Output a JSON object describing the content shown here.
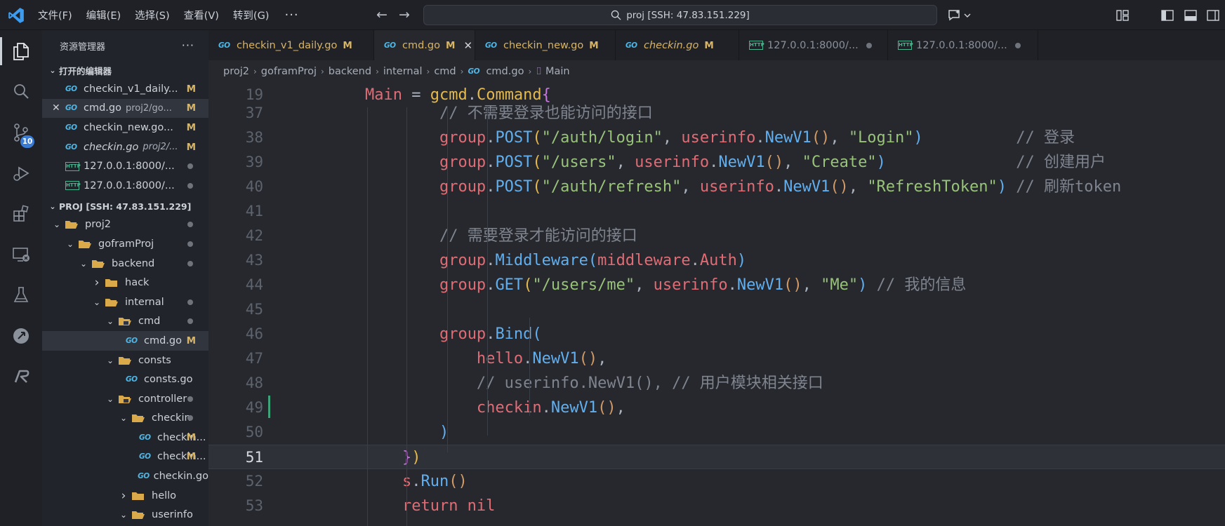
{
  "titlebar": {
    "menus": [
      "文件(F)",
      "编辑(E)",
      "选择(S)",
      "查看(V)",
      "转到(G)"
    ],
    "more": "···",
    "search_text": "proj [SSH: 47.83.151.229]"
  },
  "activity": {
    "scm_badge": "10"
  },
  "sidebar": {
    "title": "资源管理器",
    "more": "···",
    "open_editors_title": "打开的编辑器",
    "open_editors": [
      {
        "name": "checkin_v1_daily...",
        "dir": "",
        "status": "M",
        "kind": "go",
        "italic": false
      },
      {
        "name": "cmd.go",
        "dir": "proj2/go...",
        "status": "M",
        "kind": "go",
        "italic": false
      },
      {
        "name": "checkin_new.go...",
        "dir": "",
        "status": "M",
        "kind": "go",
        "italic": false
      },
      {
        "name": "checkin.go",
        "dir": "proj2/...",
        "status": "M",
        "kind": "go",
        "italic": true
      },
      {
        "name": "127.0.0.1:8000/...",
        "dir": "",
        "status": "",
        "kind": "http",
        "italic": false
      },
      {
        "name": "127.0.0.1:8000/...",
        "dir": "",
        "status": "",
        "kind": "http",
        "italic": false
      }
    ],
    "project_title": "PROJ [SSH: 47.83.151.229]",
    "tree": [
      {
        "name": "proj2",
        "type": "folder",
        "open": true,
        "depth": 0,
        "dot": true
      },
      {
        "name": "goframProj",
        "type": "folder",
        "open": true,
        "depth": 1,
        "dot": true
      },
      {
        "name": "backend",
        "type": "folder",
        "open": true,
        "depth": 2,
        "dot": true
      },
      {
        "name": "hack",
        "type": "folder",
        "open": false,
        "depth": 3,
        "dot": false
      },
      {
        "name": "internal",
        "type": "folder",
        "open": true,
        "depth": 3,
        "dot": true
      },
      {
        "name": "cmd",
        "type": "folder-special",
        "open": true,
        "depth": 4,
        "dot": true
      },
      {
        "name": "cmd.go",
        "type": "go",
        "depth": 5,
        "status": "M",
        "selected": true
      },
      {
        "name": "consts",
        "type": "folder",
        "open": true,
        "depth": 4,
        "dot": false
      },
      {
        "name": "consts.go",
        "type": "go",
        "depth": 5,
        "status": ""
      },
      {
        "name": "controller",
        "type": "folder-special",
        "open": true,
        "depth": 4,
        "dot": true
      },
      {
        "name": "checkin",
        "type": "folder",
        "open": true,
        "depth": 5,
        "dot": true
      },
      {
        "name": "checkin...",
        "type": "go",
        "depth": 6,
        "status": "M"
      },
      {
        "name": "checkin...",
        "type": "go",
        "depth": 6,
        "status": "M"
      },
      {
        "name": "checkin.go",
        "type": "go",
        "depth": 6,
        "status": ""
      },
      {
        "name": "hello",
        "type": "folder",
        "open": false,
        "depth": 5,
        "dot": false
      },
      {
        "name": "userinfo",
        "type": "folder",
        "open": true,
        "depth": 5,
        "dot": false
      }
    ]
  },
  "tabs": [
    {
      "label": "checkin_v1_daily.go",
      "status": "M",
      "kind": "go",
      "active": false,
      "italic": false
    },
    {
      "label": "cmd.go",
      "status": "M",
      "kind": "go",
      "active": true,
      "italic": false
    },
    {
      "label": "checkin_new.go",
      "status": "M",
      "kind": "go",
      "active": false,
      "italic": false
    },
    {
      "label": "checkin.go",
      "status": "M",
      "kind": "go",
      "active": false,
      "italic": true
    },
    {
      "label": "127.0.0.1:8000/...",
      "status": "",
      "kind": "http",
      "active": false,
      "italic": false
    },
    {
      "label": "127.0.0.1:8000/...",
      "status": "",
      "kind": "http",
      "active": false,
      "italic": false
    }
  ],
  "breadcrumb": [
    "proj2",
    "goframProj",
    "backend",
    "internal",
    "cmd",
    "cmd.go",
    "Main"
  ],
  "editor": {
    "current_line": "51",
    "lines": [
      {
        "n": "19",
        "tokens": [
          [
            "    ",
            "w"
          ],
          [
            "Main",
            "pink"
          ],
          [
            " = ",
            "w"
          ],
          [
            "gcmd",
            "gold"
          ],
          [
            ".",
            "w"
          ],
          [
            "Command",
            "gold"
          ],
          [
            "{",
            "purple"
          ]
        ]
      },
      {
        "n": "37",
        "tokens": [
          [
            "            ",
            "w"
          ],
          [
            "// 不需要登录也能访问的接口",
            "com"
          ]
        ]
      },
      {
        "n": "38",
        "tokens": [
          [
            "            ",
            "w"
          ],
          [
            "group",
            "pink"
          ],
          [
            ".",
            "w"
          ],
          [
            "POST",
            "blue"
          ],
          [
            "(",
            "gold"
          ],
          [
            "\"/auth/login\"",
            "green"
          ],
          [
            ", ",
            "w"
          ],
          [
            "userinfo",
            "pink"
          ],
          [
            ".",
            "w"
          ],
          [
            "NewV1",
            "blue"
          ],
          [
            "()",
            "orange"
          ],
          [
            ", ",
            "w"
          ],
          [
            "\"Login\"",
            "green"
          ],
          [
            ")",
            "blue"
          ],
          [
            "          ",
            "w"
          ],
          [
            "// 登录",
            "com"
          ]
        ]
      },
      {
        "n": "39",
        "tokens": [
          [
            "            ",
            "w"
          ],
          [
            "group",
            "pink"
          ],
          [
            ".",
            "w"
          ],
          [
            "POST",
            "blue"
          ],
          [
            "(",
            "gold"
          ],
          [
            "\"/users\"",
            "green"
          ],
          [
            ", ",
            "w"
          ],
          [
            "userinfo",
            "pink"
          ],
          [
            ".",
            "w"
          ],
          [
            "NewV1",
            "blue"
          ],
          [
            "()",
            "orange"
          ],
          [
            ", ",
            "w"
          ],
          [
            "\"Create\"",
            "green"
          ],
          [
            ")",
            "blue"
          ],
          [
            "              ",
            "w"
          ],
          [
            "// 创建用户",
            "com"
          ]
        ]
      },
      {
        "n": "40",
        "tokens": [
          [
            "            ",
            "w"
          ],
          [
            "group",
            "pink"
          ],
          [
            ".",
            "w"
          ],
          [
            "POST",
            "blue"
          ],
          [
            "(",
            "gold"
          ],
          [
            "\"/auth/refresh\"",
            "green"
          ],
          [
            ", ",
            "w"
          ],
          [
            "userinfo",
            "pink"
          ],
          [
            ".",
            "w"
          ],
          [
            "NewV1",
            "blue"
          ],
          [
            "()",
            "orange"
          ],
          [
            ", ",
            "w"
          ],
          [
            "\"RefreshToken\"",
            "green"
          ],
          [
            ")",
            "blue"
          ],
          [
            " ",
            "w"
          ],
          [
            "// 刷新token",
            "com"
          ]
        ]
      },
      {
        "n": "41",
        "tokens": []
      },
      {
        "n": "42",
        "tokens": [
          [
            "            ",
            "w"
          ],
          [
            "// 需要登录才能访问的接口",
            "com"
          ]
        ]
      },
      {
        "n": "43",
        "tokens": [
          [
            "            ",
            "w"
          ],
          [
            "group",
            "pink"
          ],
          [
            ".",
            "w"
          ],
          [
            "Middleware",
            "blue"
          ],
          [
            "(",
            "blue"
          ],
          [
            "middleware",
            "pink"
          ],
          [
            ".",
            "w"
          ],
          [
            "Auth",
            "pink"
          ],
          [
            ")",
            "blue"
          ]
        ]
      },
      {
        "n": "44",
        "tokens": [
          [
            "            ",
            "w"
          ],
          [
            "group",
            "pink"
          ],
          [
            ".",
            "w"
          ],
          [
            "GET",
            "blue"
          ],
          [
            "(",
            "gold"
          ],
          [
            "\"/users/me\"",
            "green"
          ],
          [
            ", ",
            "w"
          ],
          [
            "userinfo",
            "pink"
          ],
          [
            ".",
            "w"
          ],
          [
            "NewV1",
            "blue"
          ],
          [
            "()",
            "orange"
          ],
          [
            ", ",
            "w"
          ],
          [
            "\"Me\"",
            "green"
          ],
          [
            ")",
            "blue"
          ],
          [
            " ",
            "w"
          ],
          [
            "// 我的信息",
            "com"
          ]
        ]
      },
      {
        "n": "45",
        "tokens": []
      },
      {
        "n": "46",
        "tokens": [
          [
            "            ",
            "w"
          ],
          [
            "group",
            "pink"
          ],
          [
            ".",
            "w"
          ],
          [
            "Bind",
            "blue"
          ],
          [
            "(",
            "blue"
          ]
        ]
      },
      {
        "n": "47",
        "tokens": [
          [
            "                ",
            "w"
          ],
          [
            "hello",
            "pink"
          ],
          [
            ".",
            "w"
          ],
          [
            "NewV1",
            "blue"
          ],
          [
            "()",
            "orange"
          ],
          [
            ",",
            "w"
          ]
        ]
      },
      {
        "n": "48",
        "tokens": [
          [
            "                ",
            "w"
          ],
          [
            "// userinfo.NewV1(), // 用户模块相关接口",
            "com"
          ]
        ]
      },
      {
        "n": "49",
        "tokens": [
          [
            "                ",
            "w"
          ],
          [
            "checkin",
            "pink"
          ],
          [
            ".",
            "w"
          ],
          [
            "NewV1",
            "blue"
          ],
          [
            "()",
            "orange"
          ],
          [
            ",",
            "w"
          ]
        ]
      },
      {
        "n": "50",
        "tokens": [
          [
            "            ",
            "w"
          ],
          [
            ")",
            "blue"
          ]
        ]
      },
      {
        "n": "51",
        "tokens": [
          [
            "        ",
            "w"
          ],
          [
            "}",
            "purple"
          ],
          [
            ")",
            "gold"
          ]
        ]
      },
      {
        "n": "52",
        "tokens": [
          [
            "        ",
            "w"
          ],
          [
            "s",
            "pink"
          ],
          [
            ".",
            "w"
          ],
          [
            "Run",
            "blue"
          ],
          [
            "()",
            "orange"
          ]
        ]
      },
      {
        "n": "53",
        "tokens": [
          [
            "        ",
            "w"
          ],
          [
            "return nil",
            "pink"
          ]
        ]
      }
    ]
  },
  "colors": {
    "accent_blue": "#3a7bd5",
    "modified": "#d8b465",
    "go_icon": "#4fb6e6"
  }
}
